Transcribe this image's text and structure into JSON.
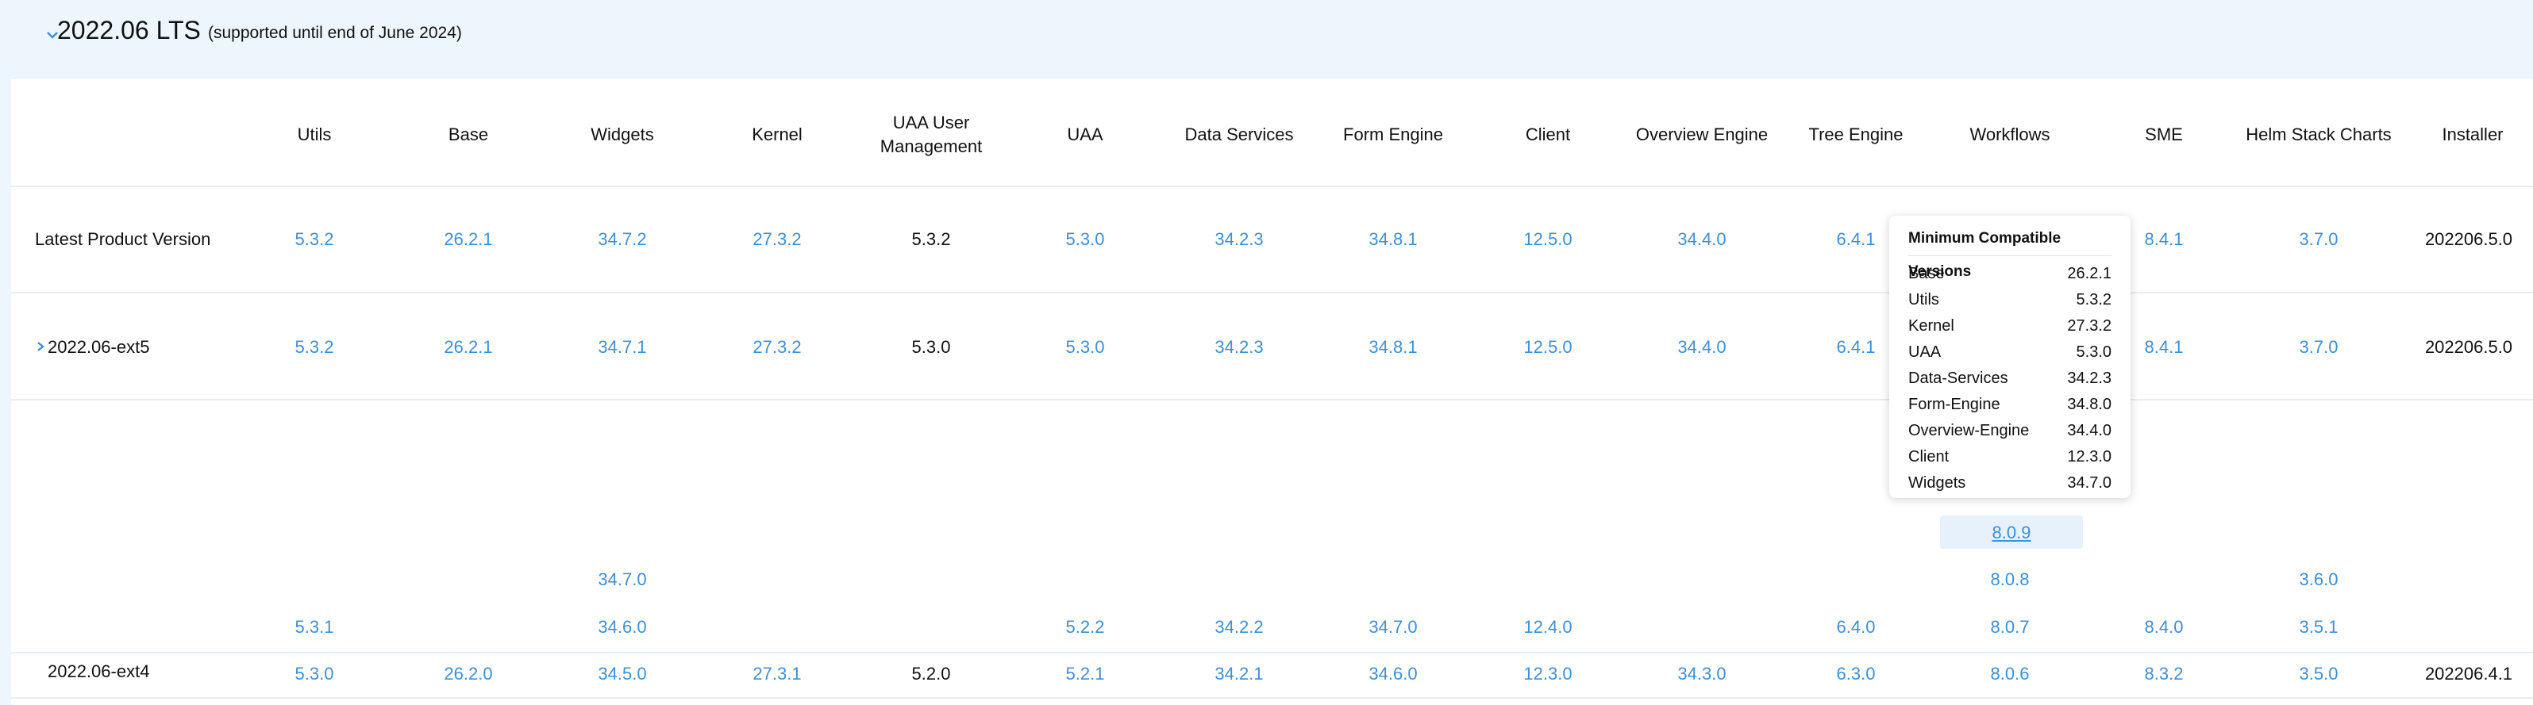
{
  "section": {
    "title": "2022.06 LTS",
    "subtitle": "(supported until end of June 2024)"
  },
  "columns": [
    "Utils",
    "Base",
    "Widgets",
    "Kernel",
    "UAA User Management",
    "UAA",
    "Data Services",
    "Form Engine",
    "Client",
    "Overview Engine",
    "Tree Engine",
    "Workflows",
    "SME",
    "Helm Stack Charts",
    "Installer"
  ],
  "rows": {
    "latest": {
      "label": "Latest Product Version",
      "utils": "5.3.2",
      "base": "26.2.1",
      "widgets": "34.7.2",
      "kernel": "27.3.2",
      "uaa_um": "5.3.2",
      "uaa": "5.3.0",
      "data_services": "34.2.3",
      "form_engine": "34.8.1",
      "client": "12.5.0",
      "overview_engine": "34.4.0",
      "tree_engine": "6.4.1",
      "sme": "8.4.1",
      "helm": "3.7.0",
      "installer": "202206.5.0"
    },
    "ext5": {
      "label": "2022.06-ext5",
      "utils": "5.3.2",
      "base": "26.2.1",
      "widgets": "34.7.1",
      "kernel": "27.3.2",
      "uaa_um": "5.3.0",
      "uaa": "5.3.0",
      "data_services": "34.2.3",
      "form_engine": "34.8.1",
      "client": "12.5.0",
      "overview_engine": "34.4.0",
      "tree_engine": "6.4.1",
      "sme": "8.4.1",
      "helm": "3.7.0",
      "installer": "202206.5.0"
    },
    "ext5_sub1": {
      "workflows": "8.0.9"
    },
    "ext5_sub2": {
      "widgets": "34.7.0",
      "workflows": "8.0.8",
      "helm": "3.6.0"
    },
    "ext5_sub3": {
      "utils": "5.3.1",
      "widgets": "34.6.0",
      "uaa": "5.2.2",
      "data_services": "34.2.2",
      "form_engine": "34.7.0",
      "client": "12.4.0",
      "tree_engine": "6.4.0",
      "workflows": "8.0.7",
      "sme": "8.4.0",
      "helm": "3.5.1"
    },
    "ext4": {
      "label": "2022.06-ext4",
      "utils": "5.3.0",
      "base": "26.2.0",
      "widgets": "34.5.0",
      "kernel": "27.3.1",
      "uaa_um": "5.2.0",
      "uaa": "5.2.1",
      "data_services": "34.2.1",
      "form_engine": "34.6.0",
      "client": "12.3.0",
      "overview_engine": "34.3.0",
      "tree_engine": "6.3.0",
      "workflows": "8.0.6",
      "sme": "8.3.2",
      "helm": "3.5.0",
      "installer": "202206.4.1"
    }
  },
  "tooltip": {
    "title": "Minimum Compatible Versions",
    "items": [
      {
        "name": "Base",
        "version": "26.2.1"
      },
      {
        "name": "Utils",
        "version": "5.3.2"
      },
      {
        "name": "Kernel",
        "version": "27.3.2"
      },
      {
        "name": "UAA",
        "version": "5.3.0"
      },
      {
        "name": "Data-Services",
        "version": "34.2.3"
      },
      {
        "name": "Form-Engine",
        "version": "34.8.0"
      },
      {
        "name": "Overview-Engine",
        "version": "34.4.0"
      },
      {
        "name": "Client",
        "version": "12.3.0"
      },
      {
        "name": "Widgets",
        "version": "34.7.0"
      }
    ]
  },
  "colors": {
    "link": "#3d8fd6",
    "header_bg": "#eef6fd",
    "divider": "#e7edf2"
  }
}
